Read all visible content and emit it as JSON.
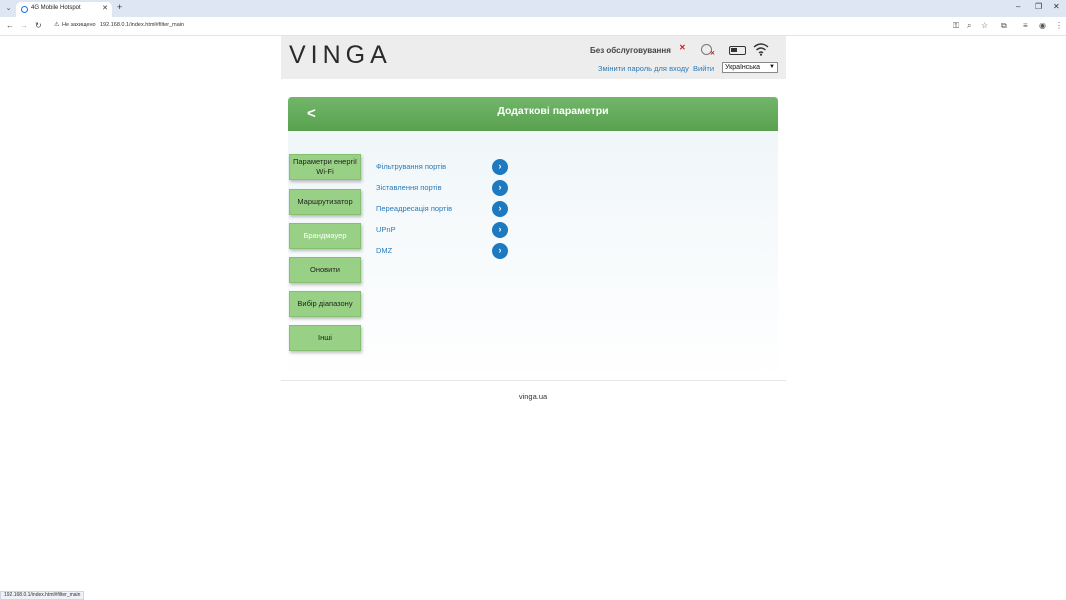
{
  "browser": {
    "tab_title": "4G Mobile Hotspot",
    "security_label": "Не захищено",
    "url": "192.168.0.1/index.html#filter_main",
    "status_url": "192.168.0.1/index.html#filter_main"
  },
  "header": {
    "logo": "VINGA",
    "service_status": "Без обслуговування",
    "change_password": "Змінити пароль для входу",
    "logout": "Вийти",
    "language": "Українська"
  },
  "panel": {
    "title": "Додаткові параметри"
  },
  "sidebar": {
    "items": [
      {
        "label": "Параметри енергії Wi-Fi"
      },
      {
        "label": "Маршрутизатор"
      },
      {
        "label": "Брандмауер"
      },
      {
        "label": "Оновити"
      },
      {
        "label": "Вибір діапазону"
      },
      {
        "label": "Інші"
      }
    ]
  },
  "options": {
    "items": [
      {
        "label": "Фільтрування портів"
      },
      {
        "label": "Зіставлення портів"
      },
      {
        "label": "Переадресація портів"
      },
      {
        "label": "UPnP"
      },
      {
        "label": "DMZ"
      }
    ]
  },
  "footer": {
    "site": "vinga.ua"
  },
  "colors": {
    "accent_green": "#59a14f",
    "link_blue": "#2a7ab8",
    "arrow_blue": "#1d79c0",
    "error_red": "#d21e1e"
  }
}
